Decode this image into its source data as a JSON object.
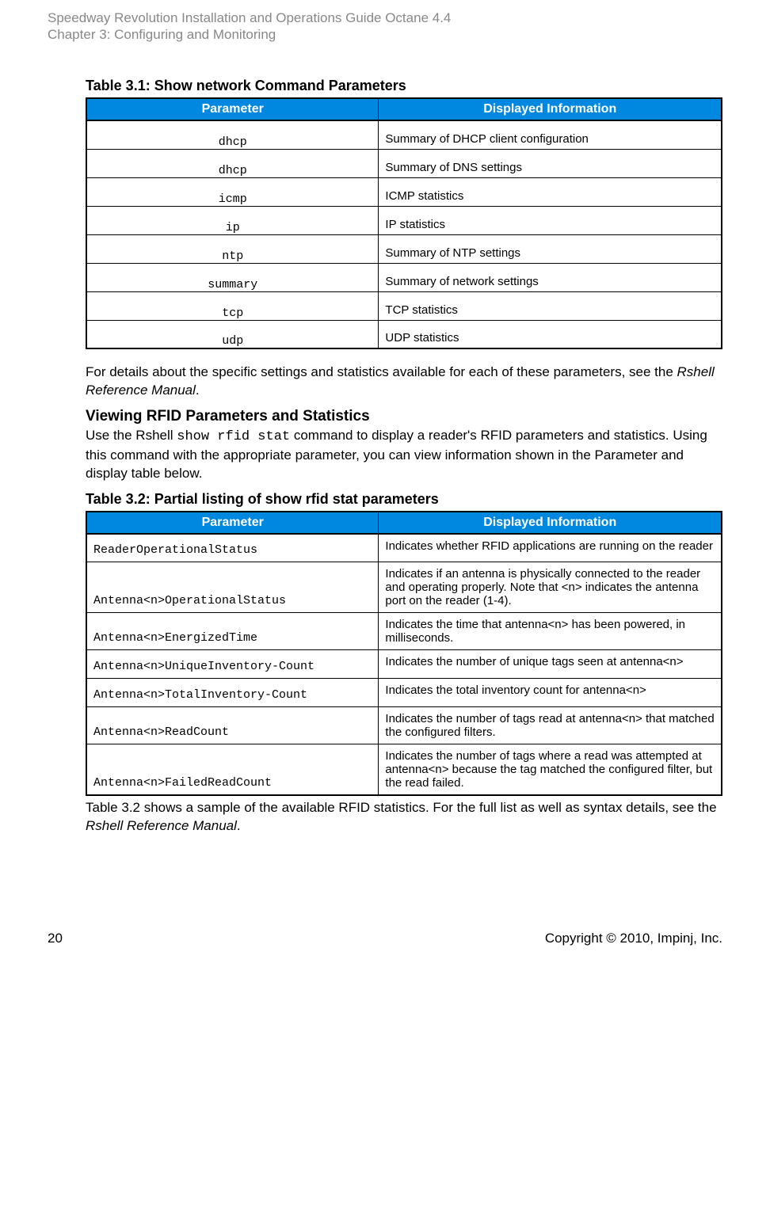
{
  "header": {
    "title": "Speedway Revolution Installation and Operations Guide Octane 4.4",
    "chapter": "Chapter 3: Configuring and Monitoring"
  },
  "table31": {
    "caption": "Table 3.1: Show network Command Parameters",
    "headers": {
      "col1": "Parameter",
      "col2": "Displayed Information"
    },
    "rows": [
      {
        "param": "dhcp",
        "desc": "Summary of DHCP client configuration"
      },
      {
        "param": "dhcp",
        "desc": "Summary of DNS settings"
      },
      {
        "param": "icmp",
        "desc": "ICMP statistics"
      },
      {
        "param": "ip",
        "desc": "IP statistics"
      },
      {
        "param": "ntp",
        "desc": "Summary of NTP settings"
      },
      {
        "param": "summary",
        "desc": "Summary of network settings"
      },
      {
        "param": "tcp",
        "desc": "TCP statistics"
      },
      {
        "param": "udp",
        "desc": "UDP statistics"
      }
    ]
  },
  "para1_a": "For details about the specific settings and statistics available for each of these parameters, see the ",
  "para1_b": "Rshell Reference Manual",
  "para1_c": ".",
  "subheading": "Viewing RFID Parameters and Statistics",
  "para2_a": "Use the Rshell ",
  "para2_cmd": "show rfid stat",
  "para2_b": " command to display a reader's RFID parameters and statistics. Using this command with the appropriate parameter, you can view information shown in the Parameter and display table below.",
  "table32": {
    "caption": "Table 3.2: Partial listing of show rfid stat parameters",
    "headers": {
      "col1": "Parameter",
      "col2": "Displayed Information"
    },
    "rows": [
      {
        "param": "ReaderOperationalStatus",
        "desc": "Indicates whether RFID applications are running on the reader"
      },
      {
        "param": "Antenna<n>OperationalStatus",
        "desc": "Indicates if an antenna is physically connected to the reader and operating properly. Note that <n> indicates the antenna port on the reader (1-4)."
      },
      {
        "param": "Antenna<n>EnergizedTime",
        "desc": "Indicates the time that antenna<n> has been powered, in milliseconds."
      },
      {
        "param": "Antenna<n>UniqueInventory-Count",
        "desc": "Indicates the number of unique tags seen at antenna<n>"
      },
      {
        "param": "Antenna<n>TotalInventory-Count",
        "desc": "Indicates the total inventory count for antenna<n>"
      },
      {
        "param": "Antenna<n>ReadCount",
        "desc": "Indicates the number of tags read at antenna<n> that matched the configured filters."
      },
      {
        "param": "Antenna<n>FailedReadCount",
        "desc": "Indicates the number of tags where a read was attempted at antenna<n> because the tag matched the configured filter, but the read failed."
      }
    ]
  },
  "para3_a": "Table 3.2 shows a sample of the available RFID statistics. For the full list as well as syntax details, see the ",
  "para3_b": "Rshell Reference Manual",
  "para3_c": ".",
  "footer": {
    "page": "20",
    "copyright": "Copyright © 2010, Impinj, Inc."
  }
}
